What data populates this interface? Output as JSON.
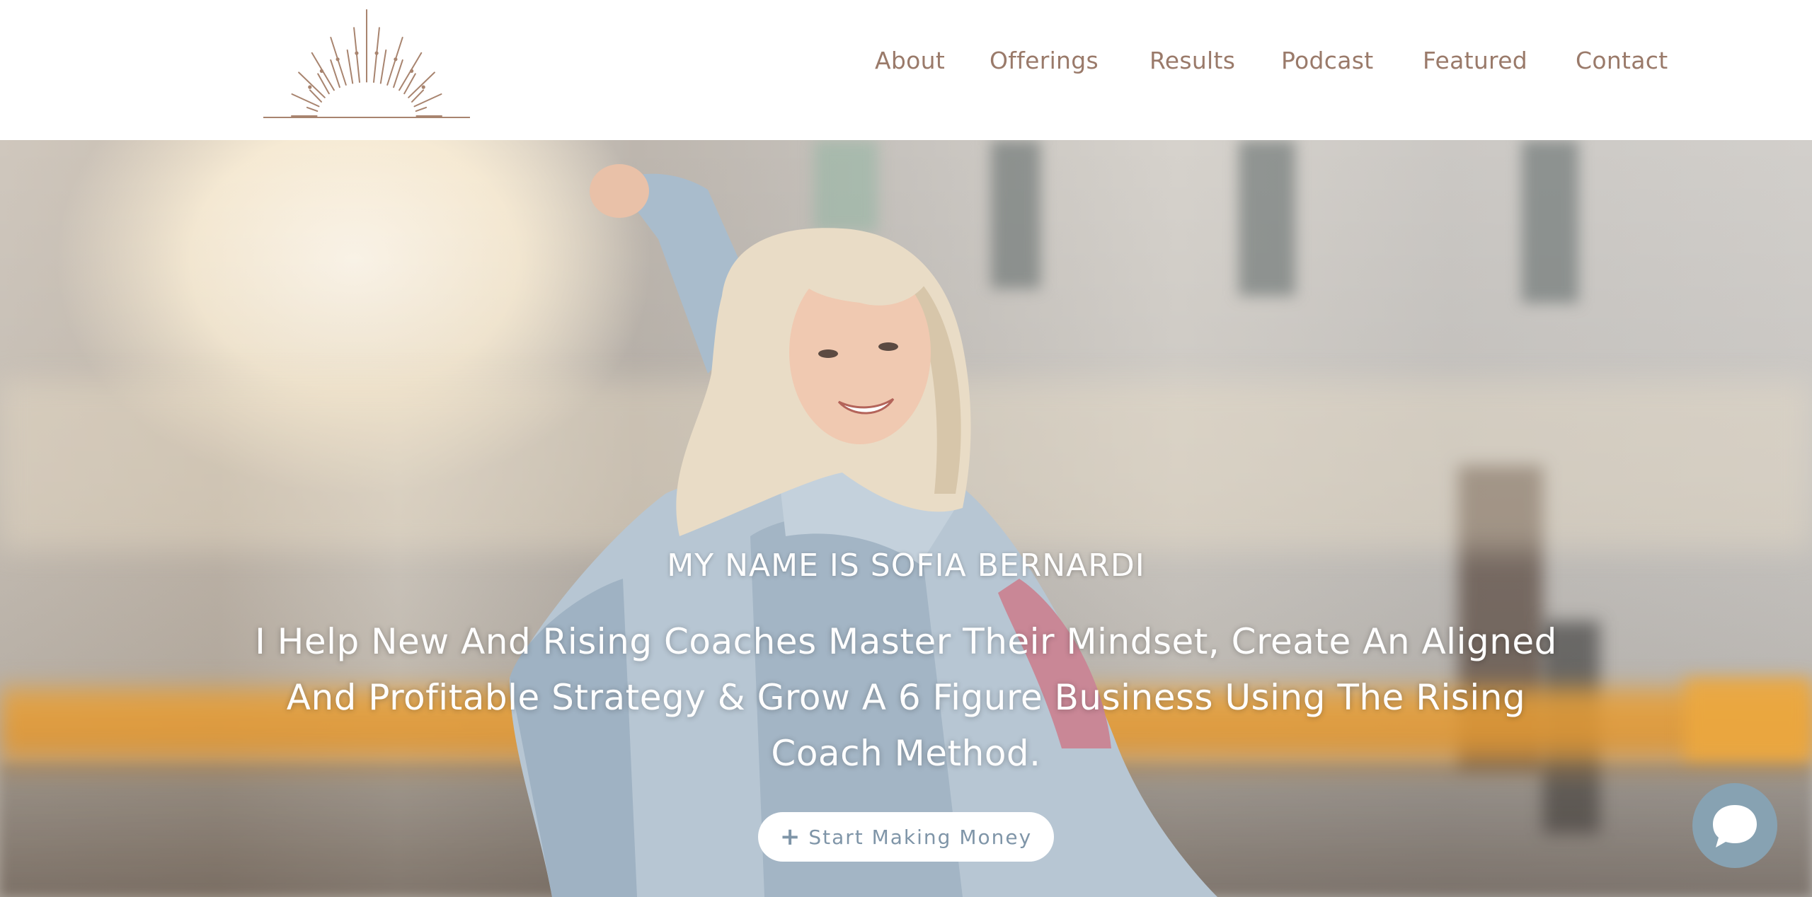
{
  "header": {
    "logo_name": "sunburst-logo",
    "nav": [
      {
        "label": "About"
      },
      {
        "label": "Offerings"
      },
      {
        "label": "Results"
      },
      {
        "label": "Podcast"
      },
      {
        "label": "Featured"
      },
      {
        "label": "Contact"
      }
    ]
  },
  "hero": {
    "eyebrow": "MY NAME IS SOFIA BERNARDI",
    "headline": "I Help New And Rising Coaches Master Their Mindset, Create An Aligned And Profitable Strategy & Grow A 6 Figure Business Using The Rising Coach Method.",
    "cta": {
      "icon": "plus-icon",
      "label": "Start Making Money"
    }
  },
  "chat_widget": {
    "icon": "chat-bubble-icon"
  },
  "colors": {
    "nav_text": "#9a7a6a",
    "logo_stroke": "#a8846f",
    "cta_text": "#7f95a8",
    "chat_bg": "#87a2b2"
  }
}
